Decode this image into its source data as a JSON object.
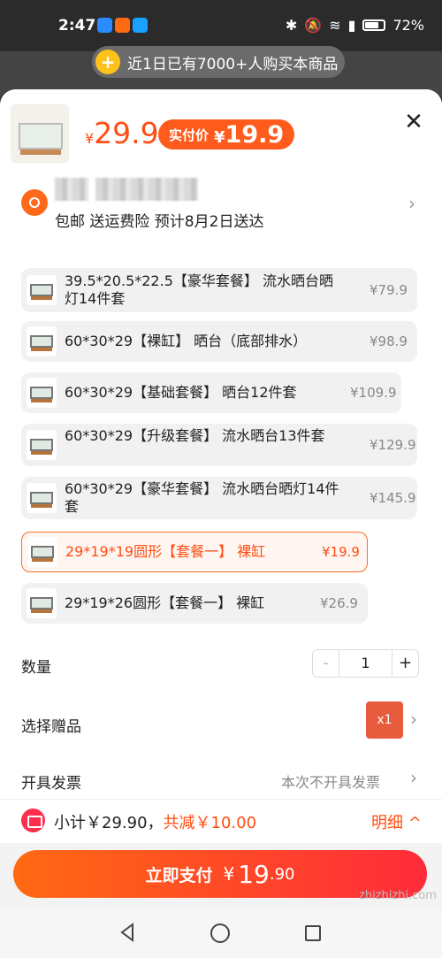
{
  "status_bar": {
    "time": "2:47",
    "battery": "72%"
  },
  "banner": {
    "icon": "plus-badge-icon",
    "text": "近1日已有7000+人购买本商品"
  },
  "header": {
    "price_symbol": "¥",
    "price": "29.9",
    "pay_label": "实付价",
    "pay_symbol": "¥",
    "pay_amount": "19.9",
    "close_icon": "close-icon"
  },
  "shipping": {
    "info": "包邮  送运费险  预计8月2日送达"
  },
  "options": [
    {
      "label": "39.5*20.5*22.5【豪华套餐】 流水晒台晒灯14件套",
      "price": "¥79.9",
      "selected": false
    },
    {
      "label": "60*30*29【裸缸】 晒台（底部排水）",
      "price": "¥98.9",
      "selected": false
    },
    {
      "label": "60*30*29【基础套餐】 晒台12件套",
      "price": "¥109.9",
      "selected": false
    },
    {
      "label": "60*30*29【升级套餐】 流水晒台13件套",
      "price": "¥129.9",
      "selected": false
    },
    {
      "label": "60*30*29【豪华套餐】 流水晒台晒灯14件套",
      "price": "¥145.9",
      "selected": false
    },
    {
      "label": "29*19*19圆形【套餐一】 裸缸",
      "price": "¥19.9",
      "selected": true
    },
    {
      "label": "29*19*26圆形【套餐一】 裸缸",
      "price": "¥26.9",
      "selected": false
    }
  ],
  "quantity": {
    "label": "数量",
    "minus": "-",
    "value": "1",
    "plus": "+"
  },
  "gift": {
    "label": "选择赠品",
    "badge": "x1"
  },
  "invoice": {
    "label": "开具发票",
    "value": "本次不开具发票"
  },
  "summary": {
    "subtotal": "小计￥29.90，",
    "discount": "共减￥10.00",
    "detail": "明细 ^"
  },
  "pay_button": {
    "label": "立即支付",
    "yen": "¥",
    "integer": "19",
    "decimal": ".90"
  },
  "watermark": "zhizhizhi.com"
}
